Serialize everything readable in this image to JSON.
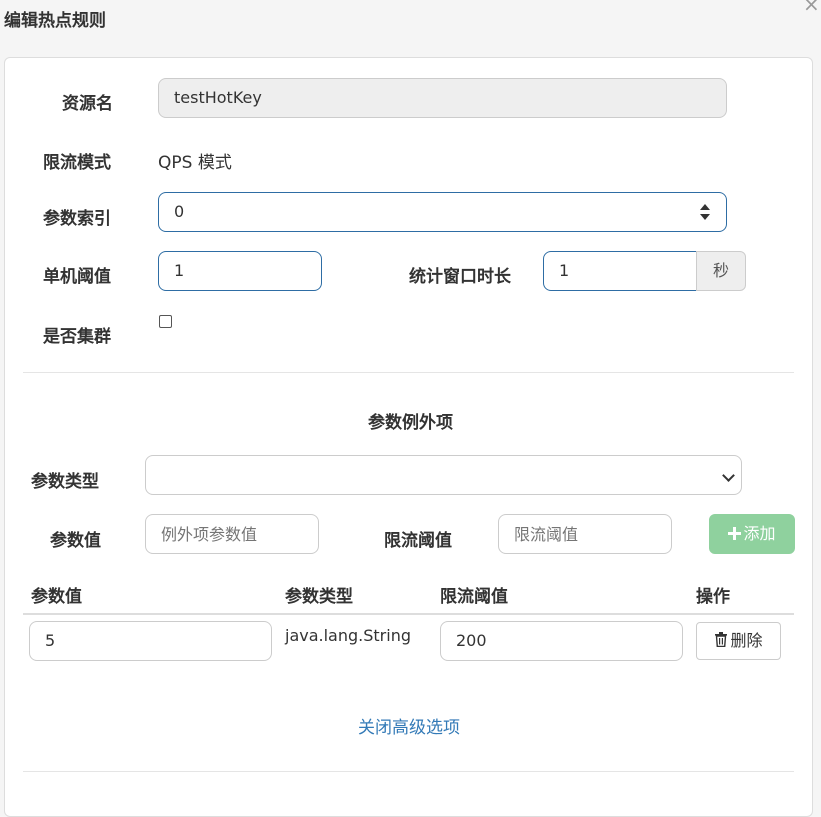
{
  "dialog": {
    "title": "编辑热点规则",
    "close_icon": "×"
  },
  "form": {
    "resource_label": "资源名",
    "resource_value": "testHotKey",
    "mode_label": "限流模式",
    "mode_value": "QPS 模式",
    "param_index_label": "参数索引",
    "param_index_value": "0",
    "threshold_label": "单机阈值",
    "threshold_value": "1",
    "window_label": "统计窗口时长",
    "window_value": "1",
    "window_unit": "秒",
    "cluster_label": "是否集群",
    "cluster_checked": false
  },
  "exceptions": {
    "section_title": "参数例外项",
    "type_label": "参数类型",
    "type_value": "",
    "value_label": "参数值",
    "value_placeholder": "例外项参数值",
    "limit_label": "限流阈值",
    "limit_placeholder": "限流阈值",
    "add_icon": "plus-icon",
    "add_button": "添加"
  },
  "table": {
    "headers": [
      "参数值",
      "参数类型",
      "限流阈值",
      "操作"
    ],
    "rows": [
      {
        "value": "5",
        "type": "java.lang.String",
        "limit": "200",
        "action": "删除",
        "action_icon": "trash-icon"
      }
    ]
  },
  "footer": {
    "advanced_link": "关闭高级选项"
  },
  "colors": {
    "primary_border": "#2e6da4",
    "link": "#337ab7",
    "success_disabled": "#8fd19e"
  }
}
